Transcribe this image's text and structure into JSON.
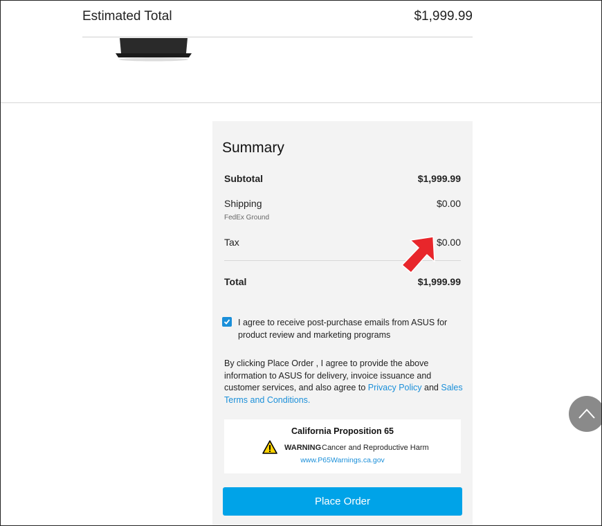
{
  "cart": {
    "estimated_total_label": "Estimated Total",
    "estimated_total_value": "$1,999.99",
    "product_image": "laptop-image"
  },
  "summary": {
    "title": "Summary",
    "subtotal_label": "Subtotal",
    "subtotal_value": "$1,999.99",
    "shipping_label": "Shipping",
    "shipping_value": "$0.00",
    "shipping_method": "FedEx Ground",
    "tax_label": "Tax",
    "tax_value": "$0.00",
    "total_label": "Total",
    "total_value": "$1,999.99"
  },
  "consent": {
    "checked": true,
    "text": "I agree to receive post-purchase emails from ASUS for product review and marketing programs"
  },
  "legal": {
    "prefix": "By clicking Place Order , I agree to provide the above information to ASUS for delivery, invoice issuance and customer services, and also agree to ",
    "privacy_link": "Privacy Policy",
    "and": " and ",
    "terms_link": "Sales Terms and Conditions",
    "suffix": "."
  },
  "prop65": {
    "title": "California Proposition 65",
    "warning_word": "WARNING",
    "warning_text": "Cancer and Reproductive Harm",
    "link": "www.P65Warnings.ca.gov"
  },
  "actions": {
    "place_order": "Place Order"
  },
  "icons": {
    "annotation": "red-arrow-icon",
    "back_to_top": "chevron-up-icon",
    "warning": "warning-triangle-icon",
    "checkbox": "checkmark-icon"
  },
  "colors": {
    "accent": "#00a3e8",
    "link": "#1a8fd9",
    "panel": "#f3f3f3",
    "annotation": "#e8262b"
  }
}
